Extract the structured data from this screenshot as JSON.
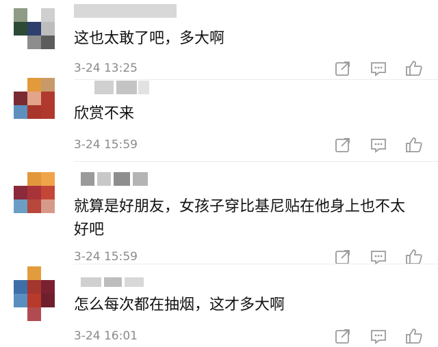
{
  "comments": [
    {
      "text": "这也太敢了吧，多大啊",
      "time": "3-24 13:25",
      "icons": [
        "share-icon",
        "comment-icon",
        "like-icon"
      ]
    },
    {
      "text": "欣赏不来",
      "time": "3-24 15:59",
      "icons": [
        "share-icon",
        "comment-icon",
        "like-icon"
      ]
    },
    {
      "text": "就算是好朋友，女孩子穿比基尼贴在他身上也不太好吧",
      "time": "3-24 15:59",
      "icons": [
        "share-icon",
        "comment-icon",
        "like-icon"
      ]
    },
    {
      "text": "怎么每次都在抽烟，这才多大啊",
      "time": "3-24 16:01",
      "icons": [
        "share-icon",
        "comment-icon",
        "like-icon"
      ]
    }
  ],
  "colors": {
    "text": "#111111",
    "meta": "#8a8a8a",
    "icon": "#9a9a9a",
    "divider": "#ececec"
  }
}
